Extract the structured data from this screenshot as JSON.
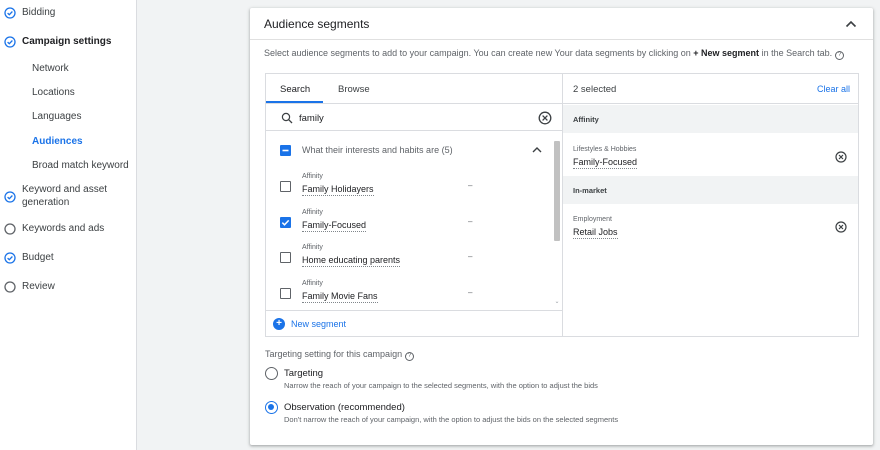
{
  "sidebar": {
    "items": [
      {
        "label": "Bidding",
        "state": "done"
      },
      {
        "label": "Campaign settings",
        "state": "done"
      },
      {
        "label": "Keyword and asset generation",
        "state": "done"
      },
      {
        "label": "Keywords and ads",
        "state": "empty"
      },
      {
        "label": "Budget",
        "state": "done"
      },
      {
        "label": "Review",
        "state": "empty"
      }
    ],
    "sub_items": [
      "Network",
      "Locations",
      "Languages",
      "Audiences",
      "Broad match keyword"
    ],
    "keyword_line1": "Keyword and asset",
    "keyword_line2": "generation"
  },
  "card": {
    "title": "Audience segments",
    "desc_pre": "Select audience segments to add to your campaign. You can create new Your data segments by clicking on ",
    "desc_bold": "+ New segment",
    "desc_post": " in the Search tab."
  },
  "picker": {
    "tabs": [
      "Search",
      "Browse"
    ],
    "search_value": "family",
    "group_label": "What their interests and habits are (5)",
    "results": [
      {
        "category": "Affinity",
        "name": "Family Holidayers",
        "checked": false,
        "dash": "–"
      },
      {
        "category": "Affinity",
        "name": "Family-Focused",
        "checked": true,
        "dash": "–"
      },
      {
        "category": "Affinity",
        "name": "Home educating parents",
        "checked": false,
        "dash": "–"
      },
      {
        "category": "Affinity",
        "name": "Family Movie Fans",
        "checked": false,
        "dash": "–"
      }
    ],
    "new_segment": "New segment"
  },
  "selected": {
    "count_label": "2 selected",
    "clear_all": "Clear all",
    "sections": [
      {
        "heading": "Affinity",
        "item_category": "Lifestyles & Hobbies",
        "item_name": "Family-Focused"
      },
      {
        "heading": "In-market",
        "item_category": "Employment",
        "item_name": "Retail Jobs"
      }
    ]
  },
  "targeting": {
    "title": "Targeting setting for this campaign",
    "options": [
      {
        "label": "Targeting",
        "desc": "Narrow the reach of your campaign to the selected segments, with the option to adjust the bids",
        "selected": false
      },
      {
        "label": "Observation (recommended)",
        "desc": "Don't narrow the reach of your campaign, with the option to adjust the bids on the selected segments",
        "selected": true
      }
    ]
  },
  "colors": {
    "accent": "#1a73e8",
    "text": "#202124",
    "muted": "#5f6368"
  }
}
